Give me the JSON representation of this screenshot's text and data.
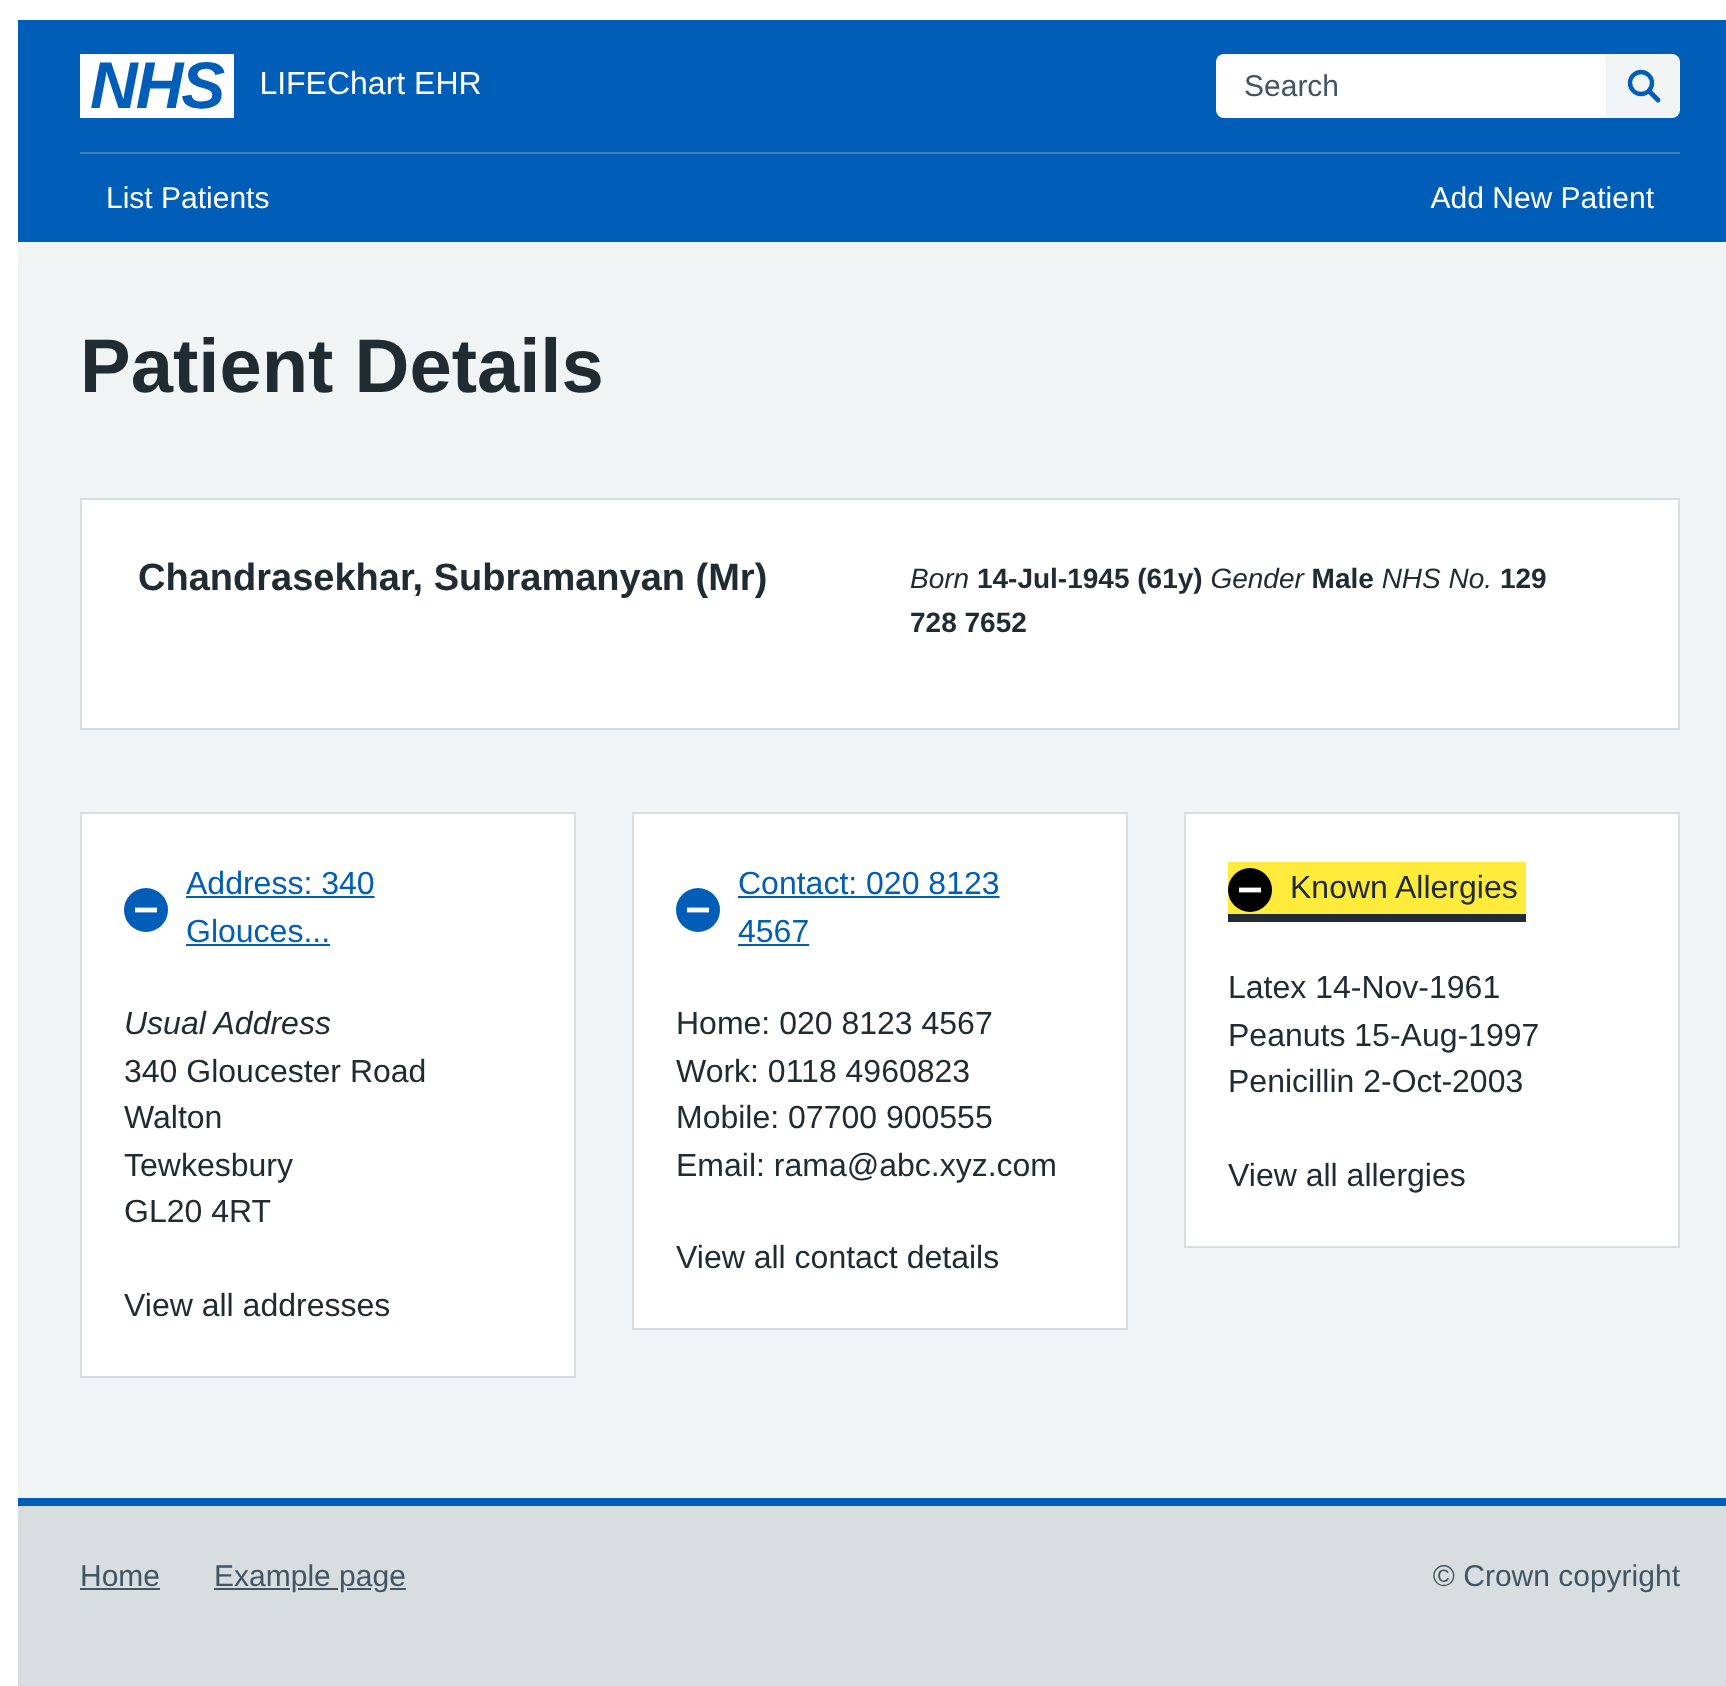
{
  "header": {
    "logo": "NHS",
    "service_name": "LIFEChart EHR",
    "search": {
      "placeholder": "Search"
    },
    "nav": [
      {
        "label": "List Patients"
      },
      {
        "label": "Add New Patient"
      }
    ]
  },
  "page_title": "Patient Details",
  "patient": {
    "name": "Chandrasekhar, Subramanyan (Mr)",
    "details": "*Born* **14-Jul-1945 (61y)** *Gender* **Male** *NHS No.* **129 728 7652**"
  },
  "cards": [
    {
      "title": "Address: 340 Glouces...",
      "expanded": true,
      "focused": false,
      "lines": [
        {
          "kind": "label",
          "text": "Usual Address"
        },
        {
          "kind": "line",
          "text": "340 Gloucester Road"
        },
        {
          "kind": "line",
          "text": "Walton"
        },
        {
          "kind": "line",
          "text": "Tewkesbury"
        },
        {
          "kind": "line",
          "text": "GL20 4RT"
        }
      ],
      "link": "View all addresses"
    },
    {
      "title": "Contact: 020 8123 4567",
      "expanded": true,
      "focused": false,
      "lines": [
        {
          "kind": "line",
          "text": "Home: 020 8123 4567"
        },
        {
          "kind": "line",
          "text": "Work: 0118 4960823"
        },
        {
          "kind": "line",
          "text": "Mobile: 07700 900555"
        },
        {
          "kind": "line",
          "text": "Email: rama@abc.xyz.com"
        }
      ],
      "link": "View all contact details"
    },
    {
      "title": "Known Allergies",
      "expanded": true,
      "focused": true,
      "lines": [
        {
          "kind": "line",
          "text": "Latex 14-Nov-1961"
        },
        {
          "kind": "line",
          "text": "Peanuts 15-Aug-1997"
        },
        {
          "kind": "line",
          "text": "Penicillin 2-Oct-2003"
        }
      ],
      "link": "View all allergies"
    }
  ],
  "footer": {
    "links": [
      "Home",
      "Example page"
    ],
    "copyright": "© Crown copyright"
  }
}
